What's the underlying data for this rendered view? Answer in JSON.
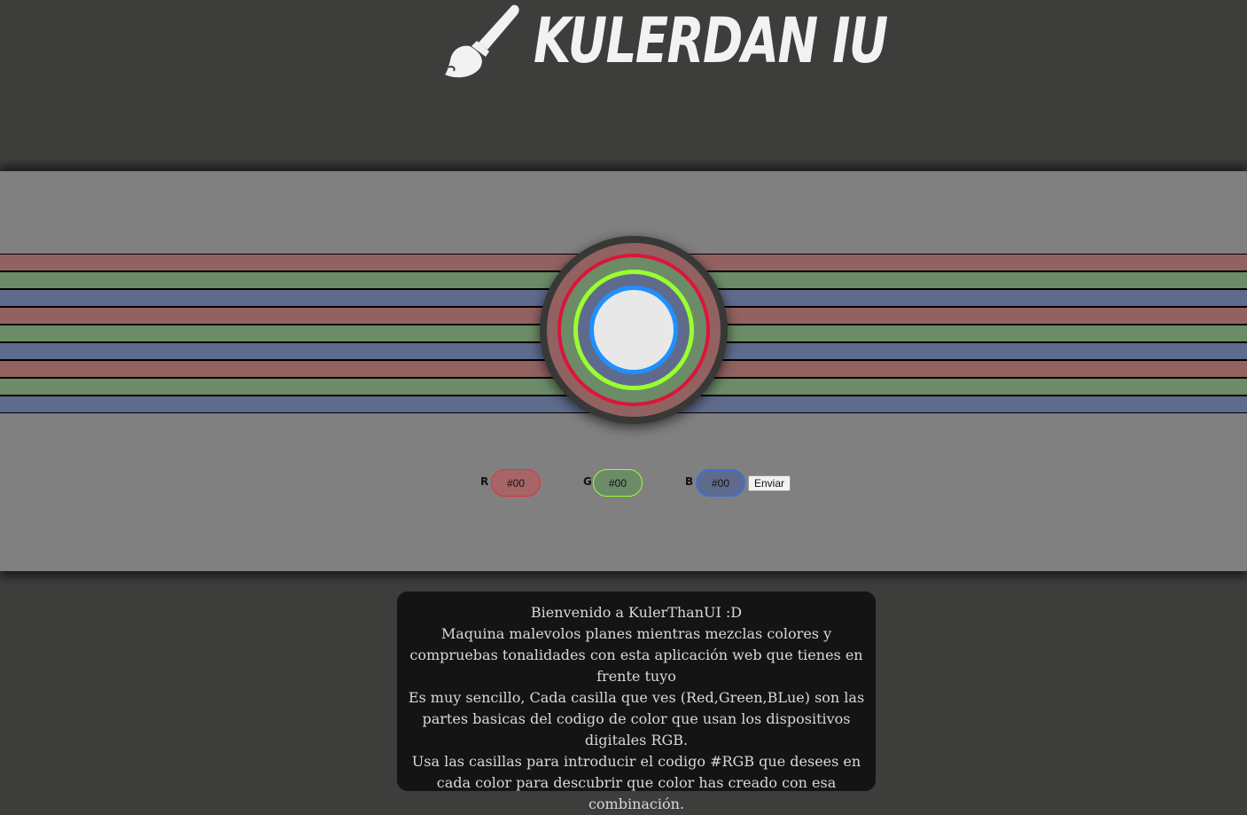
{
  "header": {
    "title": "KULERDAN IU",
    "logo_icon": "paintbrush-icon"
  },
  "colors": {
    "background": "#3d3d3c",
    "panel": "#808080",
    "stripe_red": "#926261",
    "stripe_green": "#6c8c67",
    "stripe_blue": "#5f6b8c",
    "ring_red": "#dc143c",
    "ring_green": "#9aff30",
    "ring_blue": "#1e90ff"
  },
  "controls": {
    "r_label": "R",
    "g_label": "G",
    "b_label": "B",
    "r_value": "#00",
    "g_value": "#00",
    "b_value": "#00",
    "submit_label": "Enviar"
  },
  "info": {
    "lines": [
      "Bienvenido a KulerThanUI :D",
      "Maquina malevolos planes mientras mezclas colores y compruebas tonalidades con esta aplicación web que tienes en frente tuyo",
      "Es muy sencillo, Cada casilla que ves (Red,Green,BLue) son las partes basicas del codigo de color que usan los dispositivos digitales RGB.",
      "Usa las casillas para introducir el codigo #RGB que desees en cada color para descubrir que color has creado con esa combinación."
    ]
  }
}
